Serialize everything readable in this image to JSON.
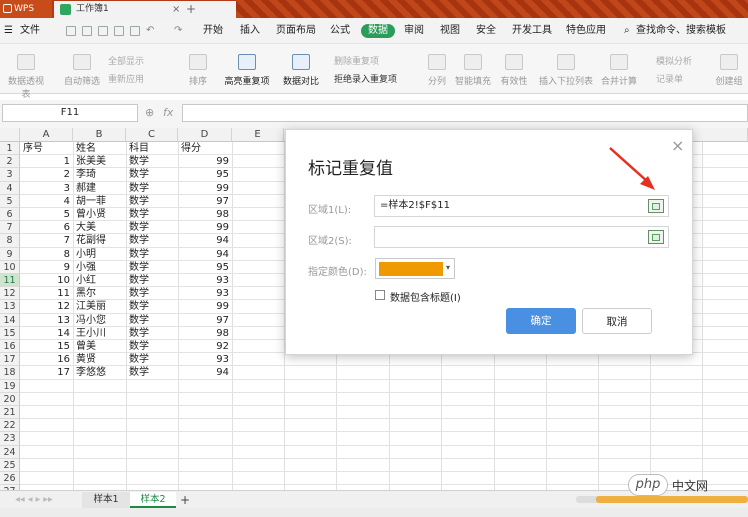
{
  "titlebar": {
    "app_label": "WPS",
    "doc_tab": "工作簿1",
    "close_glyph": "×",
    "add_glyph": "+"
  },
  "menubar": {
    "file": "文件",
    "items": [
      "开始",
      "插入",
      "页面布局",
      "公式",
      "数据",
      "审阅",
      "视图",
      "安全",
      "开发工具",
      "特色应用"
    ],
    "active_item": "数据",
    "search": "查找命令、搜索模板"
  },
  "ribbon": {
    "pivot": "数据透视表",
    "autofilter": "自动筛选",
    "show_all": "全部显示",
    "reapply": "重新应用",
    "sort": "排序",
    "highlight_dup": "高亮重复项",
    "compare": "数据对比",
    "remove_dup": "删除重复项",
    "reject_dup": "拒绝录入重复项",
    "split": "分列",
    "fill": "智能填充",
    "validity": "有效性",
    "insert_dropdown": "插入下拉列表",
    "consolidate": "合并计算",
    "simulate": "模拟分析",
    "record": "记录单",
    "create_group": "创建组"
  },
  "formulabar": {
    "namebox": "F11",
    "fx": "fx"
  },
  "sheet": {
    "columns": [
      "A",
      "B",
      "C",
      "D",
      "E"
    ],
    "rows": [
      "1",
      "2",
      "3",
      "4",
      "5",
      "6",
      "7",
      "8",
      "9",
      "10",
      "11",
      "12",
      "13",
      "14",
      "15",
      "16",
      "17",
      "18",
      "19",
      "20",
      "21",
      "22",
      "23",
      "24",
      "25",
      "26",
      "27"
    ],
    "selected_row": "11",
    "header": [
      "序号",
      "姓名",
      "科目",
      "得分"
    ],
    "data": [
      [
        "1",
        "张美美",
        "数学",
        "99"
      ],
      [
        "2",
        "李琦",
        "数学",
        "95"
      ],
      [
        "3",
        "郝建",
        "数学",
        "99"
      ],
      [
        "4",
        "胡一菲",
        "数学",
        "97"
      ],
      [
        "5",
        "曾小贤",
        "数学",
        "98"
      ],
      [
        "6",
        "大美",
        "数学",
        "99"
      ],
      [
        "7",
        "花副得",
        "数学",
        "94"
      ],
      [
        "8",
        "小明",
        "数学",
        "94"
      ],
      [
        "9",
        "小强",
        "数学",
        "95"
      ],
      [
        "10",
        "小红",
        "数学",
        "93"
      ],
      [
        "11",
        "黑尔",
        "数学",
        "93"
      ],
      [
        "12",
        "江美丽",
        "数学",
        "99"
      ],
      [
        "13",
        "冯小您",
        "数学",
        "97"
      ],
      [
        "14",
        "王小川",
        "数学",
        "98"
      ],
      [
        "15",
        "曾美",
        "数学",
        "92"
      ],
      [
        "16",
        "黄贤",
        "数学",
        "93"
      ],
      [
        "17",
        "李悠悠",
        "数学",
        "94"
      ]
    ]
  },
  "sheet_tabs": [
    "样本1",
    "样本2"
  ],
  "active_sheet": "样本2",
  "add_sheet": "+",
  "dialog": {
    "title": "标记重复值",
    "close": "×",
    "range1_label": "区域1(L):",
    "range1_value": "=样本2!$F$11",
    "range2_label": "区域2(S):",
    "range2_value": "",
    "color_label": "指定颜色(D):",
    "color": "#ee9a00",
    "checkbox_label": "数据包含标题(I)",
    "ok": "确定",
    "cancel": "取消"
  },
  "watermark": {
    "logo": "php",
    "text": "中文网"
  }
}
